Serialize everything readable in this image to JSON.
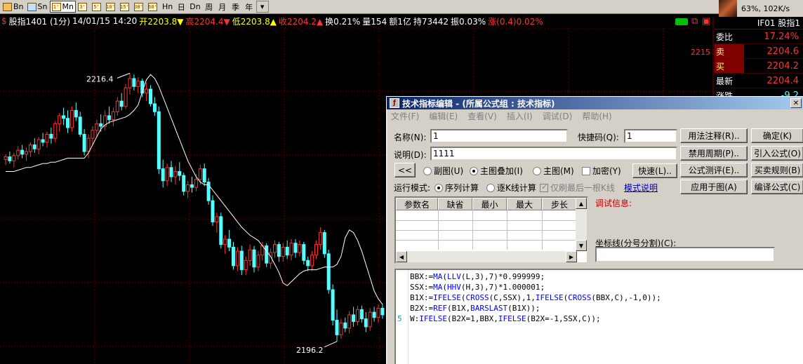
{
  "toolbar": {
    "items": [
      {
        "icon": "calendar-icon",
        "label": "Bn"
      },
      {
        "icon": "picture-icon",
        "label": "Sn"
      },
      {
        "icon": "chart-icon",
        "label": "Mn",
        "sq": "1'"
      },
      {
        "sq": "3'"
      },
      {
        "sq": "5'"
      },
      {
        "sq": "10'"
      },
      {
        "sq": "15'"
      },
      {
        "sq": "30'"
      },
      {
        "sq": "60'"
      },
      {
        "label": "Hn"
      },
      {
        "label": "日"
      },
      {
        "label": "Dn"
      },
      {
        "label": "周"
      },
      {
        "label": "月"
      },
      {
        "label": "季"
      },
      {
        "label": "年"
      }
    ],
    "more": "▾"
  },
  "ticker": {
    "text": "63%, 102K/s"
  },
  "chart_header": {
    "marker": "$",
    "symbol": "股指1401 (1分)",
    "datetime": "14/01/15 14:20",
    "open": "开2203.8▼",
    "high": "高2204.4▼",
    "low": "低2203.8▲",
    "close": "收2204.2▲",
    "turnover": "换0.21%",
    "volume": "量154",
    "amount": "额1亿",
    "hold": "持73442",
    "amplitude": "振0.03%",
    "change": "涨(0.4)0.02%"
  },
  "colors": {
    "up": "#ff3232",
    "down": "#54ffff",
    "grid": "#800000",
    "line": "#ffffff",
    "accent": "#ffff00"
  },
  "chart_data": {
    "type": "candlestick",
    "annotations": {
      "high_label": "2216.4",
      "low_label": "2196.2",
      "axis_label": "2215"
    },
    "ylim": [
      2194.5,
      2219.8
    ],
    "candles": [
      [
        2209.9,
        2210.3,
        2209.5,
        2210.1
      ],
      [
        2210.1,
        2210.5,
        2209.6,
        2209.8
      ],
      [
        2209.8,
        2210.4,
        2209.3,
        2210.2
      ],
      [
        2210.2,
        2210.9,
        2209.9,
        2210.6
      ],
      [
        2210.6,
        2211.0,
        2210.0,
        2210.3
      ],
      [
        2210.3,
        2210.8,
        2209.8,
        2210.5
      ],
      [
        2210.5,
        2211.2,
        2210.1,
        2211.0
      ],
      [
        2211.0,
        2211.5,
        2210.4,
        2210.7
      ],
      [
        2210.7,
        2211.6,
        2210.3,
        2211.4
      ],
      [
        2211.4,
        2211.9,
        2210.9,
        2211.2
      ],
      [
        2211.2,
        2212.0,
        2210.8,
        2211.8
      ],
      [
        2211.8,
        2212.3,
        2211.1,
        2211.5
      ],
      [
        2211.5,
        2212.8,
        2211.2,
        2212.6
      ],
      [
        2212.6,
        2213.4,
        2212.0,
        2213.2
      ],
      [
        2213.2,
        2213.8,
        2212.5,
        2213.0
      ],
      [
        2213.0,
        2213.6,
        2211.9,
        2212.3
      ],
      [
        2212.3,
        2213.9,
        2212.0,
        2213.6
      ],
      [
        2213.6,
        2214.2,
        2212.8,
        2213.1
      ],
      [
        2213.1,
        2213.5,
        2211.6,
        2211.8
      ],
      [
        2211.8,
        2212.2,
        2210.2,
        2210.5
      ],
      [
        2210.5,
        2211.8,
        2210.0,
        2211.5
      ],
      [
        2211.5,
        2212.4,
        2211.0,
        2212.1
      ],
      [
        2212.1,
        2212.9,
        2211.6,
        2212.6
      ],
      [
        2212.6,
        2213.3,
        2212.0,
        2212.4
      ],
      [
        2212.4,
        2213.6,
        2212.1,
        2213.2
      ],
      [
        2213.2,
        2213.9,
        2212.6,
        2212.9
      ],
      [
        2212.9,
        2213.8,
        2212.4,
        2213.5
      ],
      [
        2213.5,
        2214.6,
        2213.2,
        2214.3
      ],
      [
        2214.3,
        2214.9,
        2213.6,
        2213.9
      ],
      [
        2213.9,
        2215.6,
        2213.7,
        2215.3
      ],
      [
        2215.3,
        2216.4,
        2214.8,
        2216.0
      ],
      [
        2216.0,
        2216.3,
        2215.1,
        2215.4
      ],
      [
        2215.4,
        2216.1,
        2214.9,
        2215.8
      ],
      [
        2215.8,
        2216.0,
        2214.6,
        2214.9
      ],
      [
        2214.9,
        2215.7,
        2214.3,
        2215.2
      ],
      [
        2215.2,
        2215.5,
        2213.9,
        2214.1
      ],
      [
        2214.1,
        2214.6,
        2213.2,
        2213.5
      ],
      [
        2213.5,
        2213.9,
        2208.8,
        2209.2
      ],
      [
        2209.2,
        2209.9,
        2207.8,
        2208.3
      ],
      [
        2208.3,
        2209.6,
        2207.9,
        2209.3
      ],
      [
        2209.3,
        2209.8,
        2208.2,
        2208.6
      ],
      [
        2208.6,
        2209.4,
        2208.0,
        2209.0
      ],
      [
        2209.0,
        2209.7,
        2208.3,
        2208.7
      ],
      [
        2208.7,
        2208.9,
        2207.2,
        2207.5
      ],
      [
        2207.5,
        2208.3,
        2207.0,
        2208.0
      ],
      [
        2208.0,
        2208.6,
        2207.4,
        2207.8
      ],
      [
        2207.8,
        2208.8,
        2207.5,
        2208.4
      ],
      [
        2208.4,
        2209.5,
        2208.0,
        2209.2
      ],
      [
        2209.2,
        2209.6,
        2207.9,
        2208.2
      ],
      [
        2208.2,
        2208.5,
        2206.5,
        2206.8
      ],
      [
        2206.8,
        2207.2,
        2204.9,
        2205.2
      ],
      [
        2205.2,
        2205.9,
        2204.4,
        2205.6
      ],
      [
        2205.6,
        2205.9,
        2203.2,
        2203.5
      ],
      [
        2203.5,
        2204.2,
        2202.8,
        2203.9
      ],
      [
        2203.9,
        2204.6,
        2203.0,
        2203.3
      ],
      [
        2203.3,
        2203.7,
        2201.6,
        2201.9
      ],
      [
        2201.9,
        2203.3,
        2201.5,
        2203.0
      ],
      [
        2203.0,
        2203.4,
        2201.2,
        2201.6
      ],
      [
        2201.6,
        2202.6,
        2201.2,
        2202.3
      ],
      [
        2202.3,
        2203.5,
        2201.9,
        2203.1
      ],
      [
        2203.1,
        2203.4,
        2201.4,
        2201.8
      ],
      [
        2201.8,
        2203.0,
        2201.5,
        2202.7
      ],
      [
        2202.7,
        2203.7,
        2202.3,
        2203.4
      ],
      [
        2203.4,
        2203.6,
        2201.8,
        2202.1
      ],
      [
        2202.1,
        2203.2,
        2201.7,
        2202.9
      ],
      [
        2202.9,
        2203.8,
        2202.5,
        2203.5
      ],
      [
        2203.5,
        2203.7,
        2202.2,
        2202.6
      ],
      [
        2202.6,
        2203.6,
        2202.2,
        2203.3
      ],
      [
        2203.3,
        2203.8,
        2202.4,
        2202.7
      ],
      [
        2202.7,
        2203.9,
        2202.3,
        2203.6
      ],
      [
        2203.6,
        2203.9,
        2202.5,
        2202.9
      ],
      [
        2202.9,
        2203.8,
        2202.6,
        2203.5
      ],
      [
        2203.5,
        2203.7,
        2202.0,
        2202.3
      ],
      [
        2202.3,
        2202.6,
        2201.5,
        2201.9
      ],
      [
        2201.9,
        2203.0,
        2201.5,
        2202.7
      ],
      [
        2202.7,
        2203.8,
        2202.4,
        2203.5
      ],
      [
        2203.5,
        2204.8,
        2203.1,
        2204.4
      ],
      [
        2204.4,
        2204.6,
        2202.5,
        2202.8
      ],
      [
        2202.8,
        2203.1,
        2199.8,
        2200.1
      ],
      [
        2200.1,
        2200.5,
        2197.4,
        2197.8
      ],
      [
        2197.8,
        2198.6,
        2196.2,
        2196.7
      ],
      [
        2196.7,
        2197.9,
        2196.4,
        2197.6
      ],
      [
        2197.6,
        2198.0,
        2196.9,
        2197.2
      ],
      [
        2197.2,
        2198.5,
        2196.8,
        2198.2
      ],
      [
        2198.2,
        2198.8,
        2197.3,
        2197.7
      ],
      [
        2197.7,
        2198.9,
        2197.4,
        2198.6
      ],
      [
        2198.6,
        2198.9,
        2197.6,
        2197.9
      ],
      [
        2197.9,
        2198.4,
        2196.9,
        2197.3
      ],
      [
        2197.3,
        2198.7,
        2197.0,
        2198.4
      ],
      [
        2198.4,
        2198.8,
        2197.7,
        2198.0
      ],
      [
        2198.0,
        2199.0,
        2197.6,
        2198.7
      ],
      [
        2198.7,
        2199.0,
        2197.9,
        2198.2
      ]
    ],
    "line": [
      2209.0,
      2209.0,
      2209.0,
      2209.1,
      2209.2,
      2209.3,
      2209.3,
      2209.4,
      2209.5,
      2209.6,
      2209.6,
      2209.7,
      2209.7,
      2209.8,
      2209.9,
      2210.0,
      2210.0,
      2210.0,
      2210.0,
      2210.0,
      2210.4,
      2211.0,
      2211.6,
      2212.2,
      2212.5,
      2212.7,
      2212.8,
      2212.9,
      2213.0,
      2213.1,
      2213.3,
      2213.6,
      2214.0,
      2215.0,
      2215.9,
      2216.3,
      2216.0,
      2215.4,
      2214.6,
      2213.8,
      2213.0,
      2212.2,
      2211.4,
      2210.6,
      2209.8,
      2209.2,
      2208.6,
      2208.2,
      2208.0,
      2208.0,
      2207.6,
      2207.2,
      2206.8,
      2206.4,
      2206.0,
      2205.6,
      2205.2,
      2204.8,
      2204.5,
      2204.2,
      2204.0,
      2203.8,
      2203.4,
      2203.0,
      2202.6,
      2202.0,
      2201.4,
      2200.6,
      2200.4,
      2200.7,
      2201.0,
      2201.3,
      2201.5,
      2201.6,
      2201.6,
      2201.6,
      2201.7,
      2201.8,
      2201.8,
      2201.8,
      2202.0,
      2202.6,
      2204.0,
      2204.6,
      2204.4,
      2203.8,
      2203.0,
      2202.0,
      2201.0,
      2200.0,
      2199.4,
      2199.0
    ]
  },
  "quote": {
    "title": "IF01 股指1",
    "rows": [
      {
        "k": "委比",
        "v": "17.24%",
        "color": "#ff3232"
      },
      {
        "k": "卖",
        "v": "2204.6",
        "color": "#ff3232",
        "kbg": "#800000"
      },
      {
        "k": "买",
        "v": "2204.2",
        "color": "#ff3232",
        "kbg": "#800000"
      },
      {
        "k": "最新",
        "v": "2204.4",
        "color": "#ff3232"
      },
      {
        "k": "涨跌",
        "v": "-9.2",
        "color": "#54ffff"
      }
    ]
  },
  "dialog": {
    "title": "技术指标编辑 - (所属公式组 : 技术指标)",
    "menu": [
      "文件(F)",
      "编辑(E)",
      "查看(V)",
      "插入(I)",
      "调试(D)",
      "帮助(H)"
    ],
    "name_label": "名称(N):",
    "name_value": "1",
    "shortcut_label": "快捷码(Q):",
    "shortcut_value": "1",
    "desc_label": "说明(D):",
    "desc_value": "1111",
    "back_button": "<<",
    "radio_sub": "副图(U)",
    "radio_overlay": "主图叠加(I)",
    "radio_main": "主图(M)",
    "check_encrypt": "加密(Y)",
    "quick_button": "快速(L)..",
    "mode_label": "运行模式:",
    "mode_sequence": "序列计算",
    "mode_kline": "逐K线计算",
    "check_last": "仅刷最后一根K线",
    "mode_help": "模式说明",
    "buttons": {
      "usage": "用法注释(R)..",
      "ok": "确定(K)",
      "disable_period": "禁用周期(P)..",
      "import": "引入公式(O)",
      "test": "公式测评(E)..",
      "rules": "买卖规则(B)",
      "apply": "应用于图(A)",
      "compile": "编译公式(C)"
    },
    "param_headers": [
      "参数名",
      "缺省",
      "最小",
      "最大",
      "步长"
    ],
    "debug_label": "调试信息:",
    "axis_label": "坐标线(分号分割)(C):",
    "axis_value": "",
    "code_lines": [
      {
        "ln": "",
        "text": "BBX:=MA(LLV(L,3),7)*0.999999;"
      },
      {
        "ln": "",
        "text": "SSX:=MA(HHV(H,3),7)*1.000001;"
      },
      {
        "ln": "",
        "text": "B1X:=IFELSE(CROSS(C,SSX),1,IFELSE(CROSS(BBX,C),-1,0));"
      },
      {
        "ln": "",
        "text": "B2X:=REF(B1X,BARSLAST(B1X));"
      },
      {
        "ln": "5",
        "text": "W:IFELSE(B2X=1,BBX,IFELSE(B2X=-1,SSX,C));"
      }
    ]
  }
}
